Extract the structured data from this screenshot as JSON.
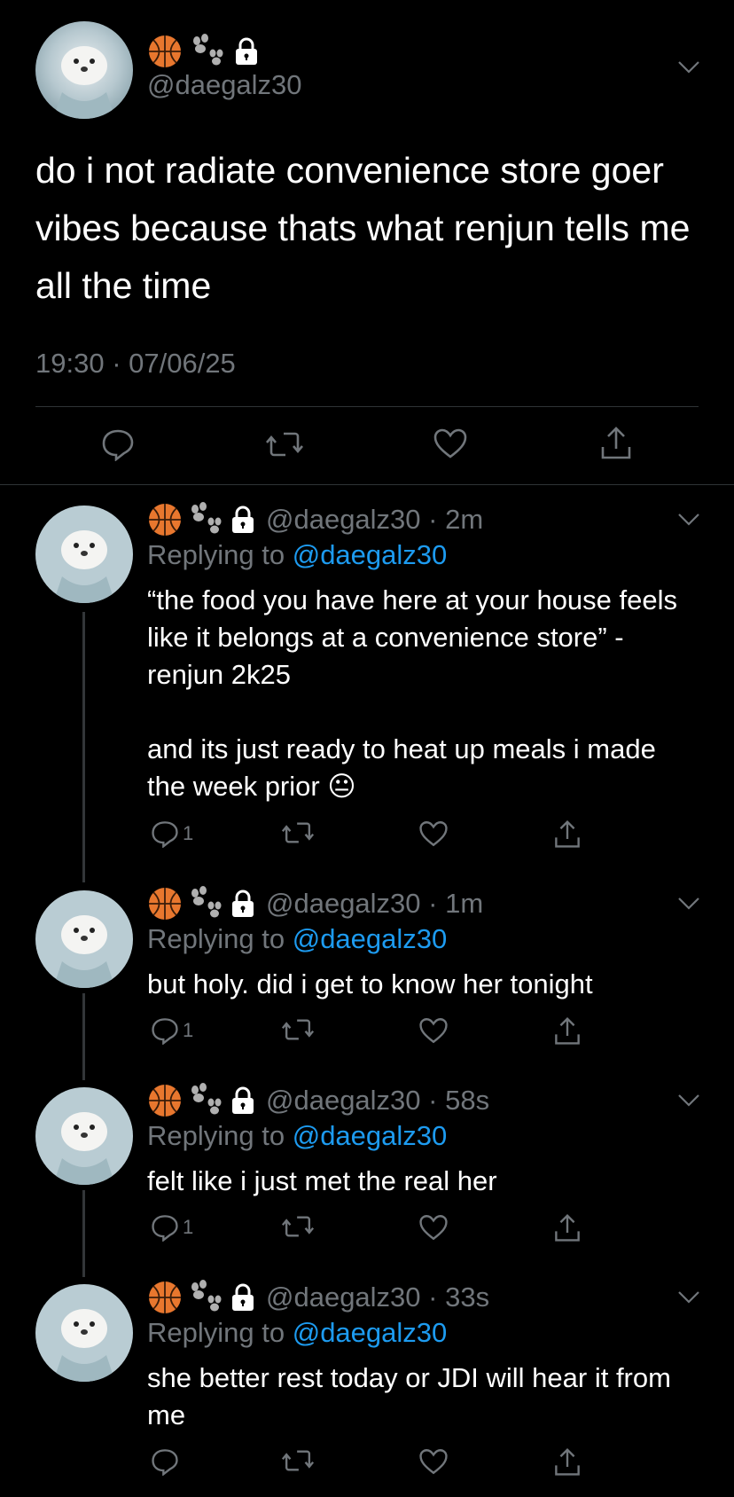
{
  "main_tweet": {
    "handle": "@daegalz30",
    "name_emojis": [
      "🏀",
      "🐾",
      "🔒"
    ],
    "text": "do i not radiate convenience store goer vibes because thats what renjun tells me all the time",
    "timestamp": "19:30 · 07/06/25"
  },
  "replies": [
    {
      "handle": "@daegalz30",
      "time": "2m",
      "replying_label": "Replying to ",
      "replying_to": "@daegalz30",
      "text": "“the food you have here at your house feels like it belongs at a convenience store” - renjun 2k25\n\nand its just ready to heat up meals i made the week prior 😐",
      "reply_count": "1"
    },
    {
      "handle": "@daegalz30",
      "time": "1m",
      "replying_label": "Replying to ",
      "replying_to": "@daegalz30",
      "text": "but holy. did i get to know her tonight",
      "reply_count": "1"
    },
    {
      "handle": "@daegalz30",
      "time": "58s",
      "replying_label": "Replying to ",
      "replying_to": "@daegalz30",
      "text": "felt like i just met the real her",
      "reply_count": "1"
    },
    {
      "handle": "@daegalz30",
      "time": "33s",
      "replying_label": "Replying to ",
      "replying_to": "@daegalz30",
      "text": "she better rest today or JDI will hear it from me",
      "reply_count": ""
    }
  ],
  "colors": {
    "background": "#000000",
    "muted": "#71767b",
    "link": "#1d9bf0",
    "divider": "#2f3336"
  },
  "icons": [
    "reply-icon",
    "retweet-icon",
    "like-icon",
    "share-icon",
    "chevron-down-icon",
    "lock-icon",
    "paw-icon",
    "basketball-icon"
  ]
}
